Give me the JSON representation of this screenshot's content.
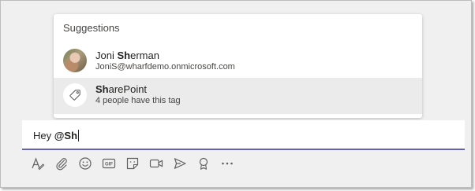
{
  "suggestions": {
    "title": "Suggestions",
    "items": [
      {
        "name_match": "Joni ",
        "name_bold": "Sh",
        "name_rest": "erman",
        "subtitle": "JoniS@wharfdemo.onmicrosoft.com",
        "icon": "user-avatar"
      },
      {
        "name_match": "",
        "name_bold": "Sh",
        "name_rest": "arePoint",
        "subtitle": "4 people have this tag",
        "icon": "tag-icon"
      }
    ]
  },
  "compose": {
    "text_plain": "Hey ",
    "text_mention": "@Sh"
  },
  "toolbar": {
    "icons": [
      "format-icon",
      "attach-icon",
      "emoji-icon",
      "gif-icon",
      "sticker-icon",
      "meet-now-icon",
      "send-icon",
      "praise-icon",
      "more-options-icon"
    ]
  },
  "colors": {
    "accent": "#6264a7",
    "highlight_row": "#ebebeb",
    "icon": "#616161"
  }
}
